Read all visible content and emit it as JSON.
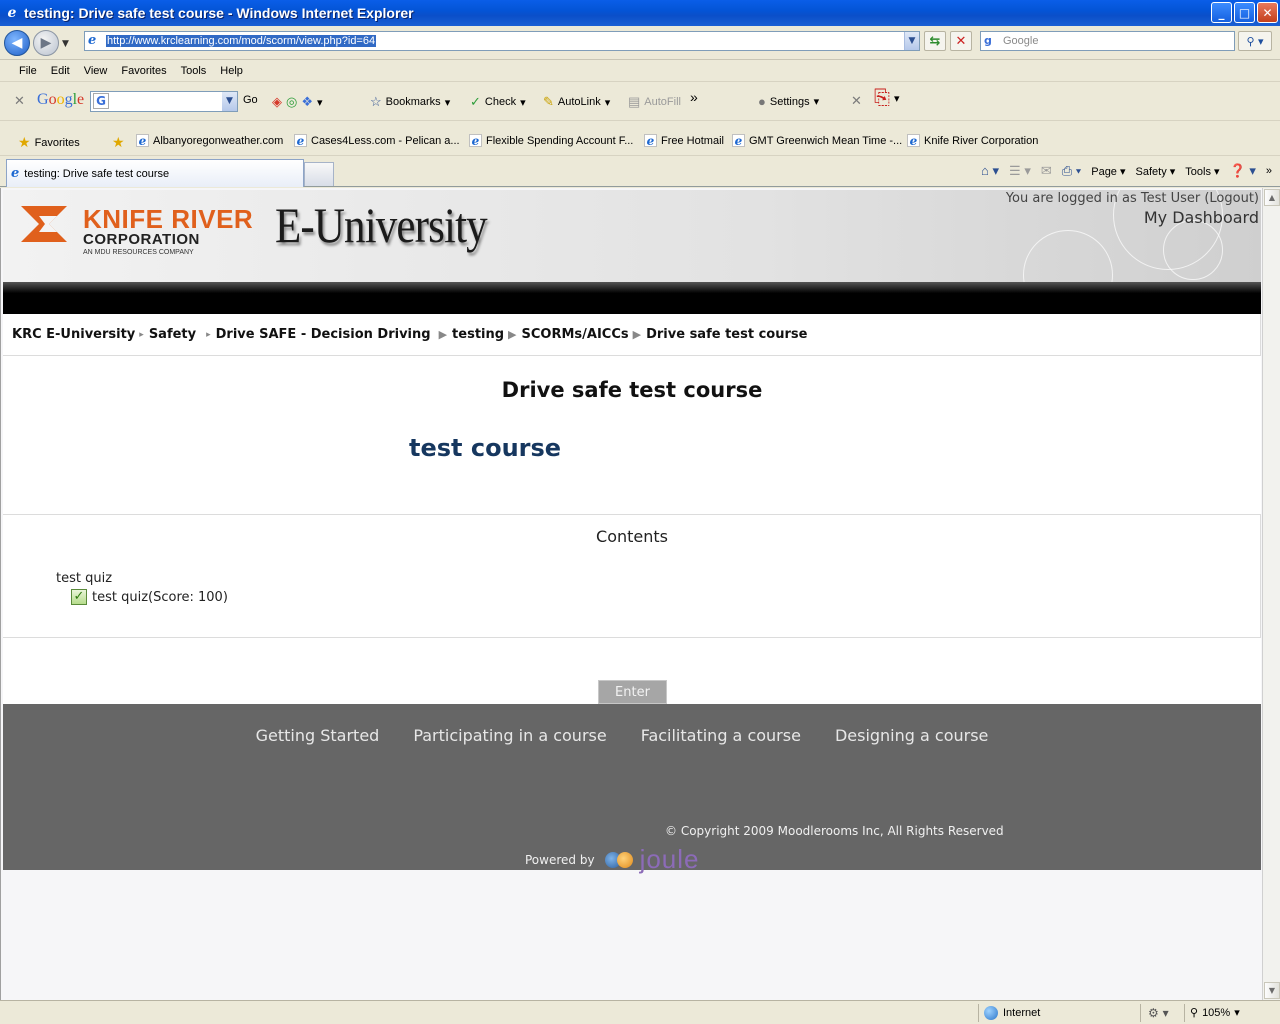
{
  "window": {
    "title": "testing: Drive safe test course - Windows Internet Explorer",
    "minimize": "_",
    "maximize": "□",
    "close": "✕"
  },
  "address_bar": {
    "url": "http://www.krclearning.com/mod/scorm/view.php?id=64",
    "search_placeholder": "Google"
  },
  "menu": [
    "File",
    "Edit",
    "View",
    "Favorites",
    "Tools",
    "Help"
  ],
  "google_toolbar": {
    "logo": "Google",
    "go": "Go",
    "bookmarks": "Bookmarks",
    "check": "Check",
    "autolink": "AutoLink",
    "autofill": "AutoFill",
    "settings": "Settings",
    "more": "»"
  },
  "favorites_bar": {
    "favorites_label": "Favorites",
    "items": [
      "Albanyoregonweather.com",
      "Cases4Less.com - Pelican a...",
      "Flexible Spending Account F...",
      "Free Hotmail",
      "GMT Greenwich Mean Time -...",
      "Knife River Corporation"
    ]
  },
  "tab": {
    "title": "testing: Drive safe test course"
  },
  "command_bar": {
    "page": "Page",
    "safety": "Safety",
    "tools": "Tools",
    "more": "»"
  },
  "site_header": {
    "logo_line1": "KNIFE RIVER",
    "logo_line2": "CORPORATION",
    "logo_line3": "AN MDU RESOURCES COMPANY",
    "site_name": "E-University",
    "login_text": "You are logged in as Test User (Logout)",
    "dashboard_link": "My Dashboard"
  },
  "breadcrumb": [
    "KRC E-University",
    "Safety",
    "Drive SAFE - Decision Driving",
    "testing",
    "SCORMs/AICCs",
    "Drive safe test course"
  ],
  "course": {
    "title": "Drive safe test course",
    "summary": "test course",
    "contents_heading": "Contents",
    "toc_parent": "test quiz",
    "toc_child": "test quiz(Score: 100)",
    "enter_button": "Enter"
  },
  "footer": {
    "links": [
      "Getting Started",
      "Participating in a course",
      "Facilitating a course",
      "Designing a course"
    ],
    "copyright": "© Copyright 2009 Moodlerooms Inc, All Rights Reserved",
    "powered_by": "Powered by",
    "brand": "joule"
  },
  "status_bar": {
    "zone": "Internet",
    "zoom": "105%"
  },
  "colors": {
    "accent_orange": "#e0601c",
    "summary_navy": "#16375f",
    "footer_gray": "#666666"
  }
}
